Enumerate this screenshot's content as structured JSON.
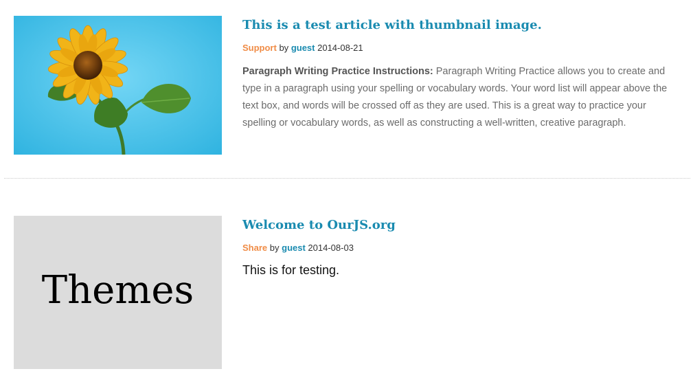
{
  "articles": [
    {
      "title": "This is a test article with thumbnail image.",
      "category": "Support",
      "by": "by",
      "author": "guest",
      "date": "2014-08-21",
      "summary_lead": "Paragraph Writing Practice Instructions:",
      "summary_text": "Paragraph Writing Practice allows you to create and type in a paragraph using your spelling or vocabulary words. Your word list will appear above the text box, and words will be crossed off as they are used. This is a great way to practice your spelling or vocabulary words, as well as constructing a well-written, creative paragraph.",
      "thumbnail": "sunflower-image"
    },
    {
      "title": "Welcome to OurJS.org",
      "category": "Share",
      "by": "by",
      "author": "guest",
      "date": "2014-08-03",
      "body": "This is for testing.",
      "thumbnail_text": "Themes"
    }
  ],
  "colors": {
    "title": "#1a8bb0",
    "category": "#f08c46",
    "author": "#1a8bb0",
    "sky": "#4ec3ea"
  }
}
